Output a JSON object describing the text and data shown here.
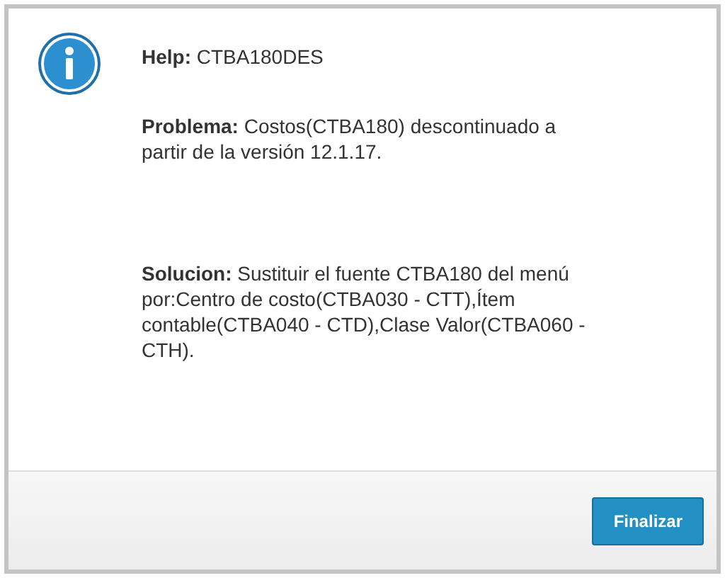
{
  "dialog": {
    "title": "**Help:** CTBA180DES",
    "paragraphs": [
      "**Problema:** Costos(CTBA180) descontinuado a partir de la versión 12.1.17.",
      "**Solucion:** Sustituir el fuente CTBA180 del menú por:Centro de costo(CTBA030 - CTT),Ítem contable(CTBA040 - CTD),Clase Valor(CTBA060 - CTH)."
    ],
    "buttons": [
      "Finalizar"
    ]
  }
}
